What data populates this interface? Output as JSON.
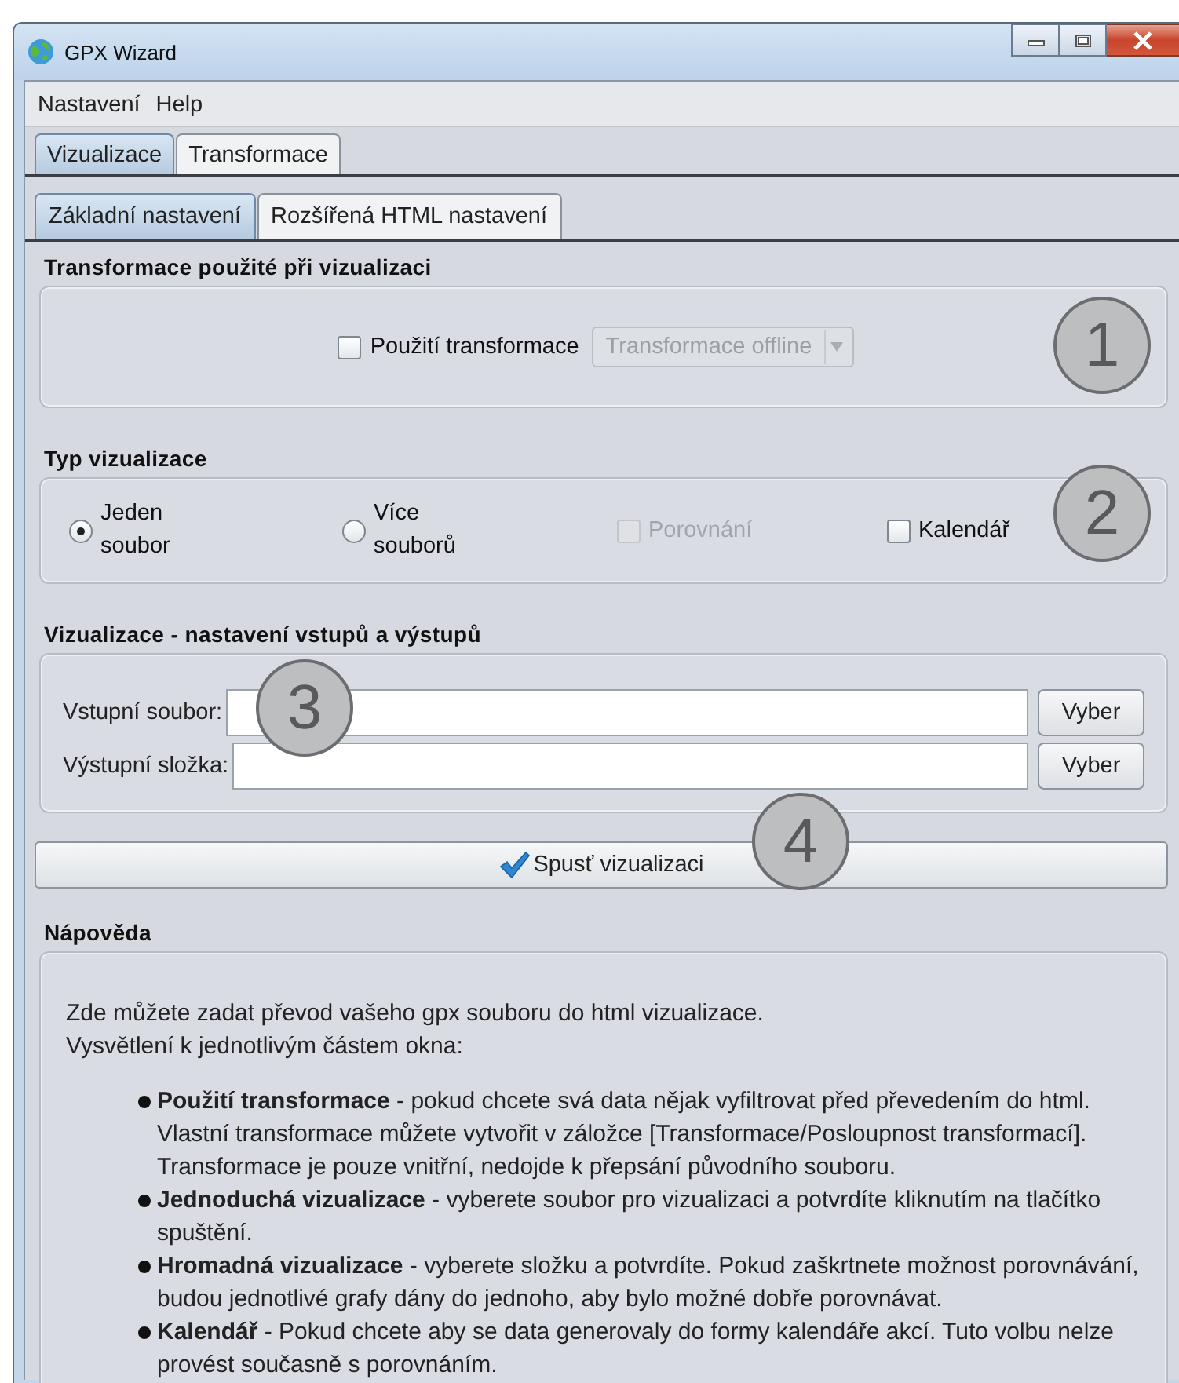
{
  "window": {
    "title": "GPX Wizard"
  },
  "menu": [
    "Nastavení",
    "Help"
  ],
  "tabs": [
    {
      "label": "Vizualizace",
      "selected": true
    },
    {
      "label": "Transformace",
      "selected": false
    }
  ],
  "subtabs": [
    {
      "label": "Základní nastavení",
      "selected": true
    },
    {
      "label": "Rozšířená HTML nastavení",
      "selected": false
    }
  ],
  "transform_section": {
    "heading": "Transformace použité při vizualizaci",
    "checkbox": {
      "label": "Použití transformace",
      "checked": false
    },
    "dropdown": {
      "value": "Transformace offline",
      "disabled": true
    }
  },
  "type_section": {
    "heading": "Typ vizualizace",
    "options": [
      {
        "kind": "radio",
        "label": "Jeden soubor",
        "selected": true,
        "disabled": false
      },
      {
        "kind": "radio",
        "label": "Více souborů",
        "selected": false,
        "disabled": false
      },
      {
        "kind": "checkbox",
        "label": "Porovnání",
        "checked": false,
        "disabled": true
      },
      {
        "kind": "checkbox",
        "label": "Kalendář",
        "checked": false,
        "disabled": false
      }
    ]
  },
  "io_section": {
    "heading": "Vizualizace - nastavení vstupů a výstupů",
    "fields": [
      {
        "label": "Vstupní soubor:",
        "button": "Vyber"
      },
      {
        "label": "Výstupní složka:",
        "button": "Vyber"
      }
    ]
  },
  "run_button": "Spusť vizualizaci",
  "help": {
    "heading": "Nápověda",
    "intro": [
      "Zde můžete zadat převod vašeho gpx souboru do html vizualizace.",
      "Vysvětlení k jednotlivým částem okna:"
    ],
    "bullets": [
      "**Použití transformace** - pokud chcete svá data nějak vyfiltrovat před převedením do html. Vlastní transformace můžete vytvořit v záložce [Transformace/Posloupnost transformací]. Transformace je pouze vnitřní, nedojde k přepsání původního souboru.",
      "**Jednoduchá vizualizace** - vyberete soubor pro vizualizaci a potvrdíte kliknutím na tlačítko spuštění.",
      "**Hromadná vizualizace** - vyberete složku a potvrdíte. Pokud zaškrtnete možnost porovnávání, budou jednotlivé grafy dány do jednoho, aby bylo možné dobře porovnávat.",
      "**Kalendář** - Pokud chcete aby se data generovaly do formy kalendáře akcí. Tuto volbu nelze provést současně s porovnáním."
    ]
  },
  "callouts": [
    "1",
    "2",
    "3",
    "4"
  ]
}
